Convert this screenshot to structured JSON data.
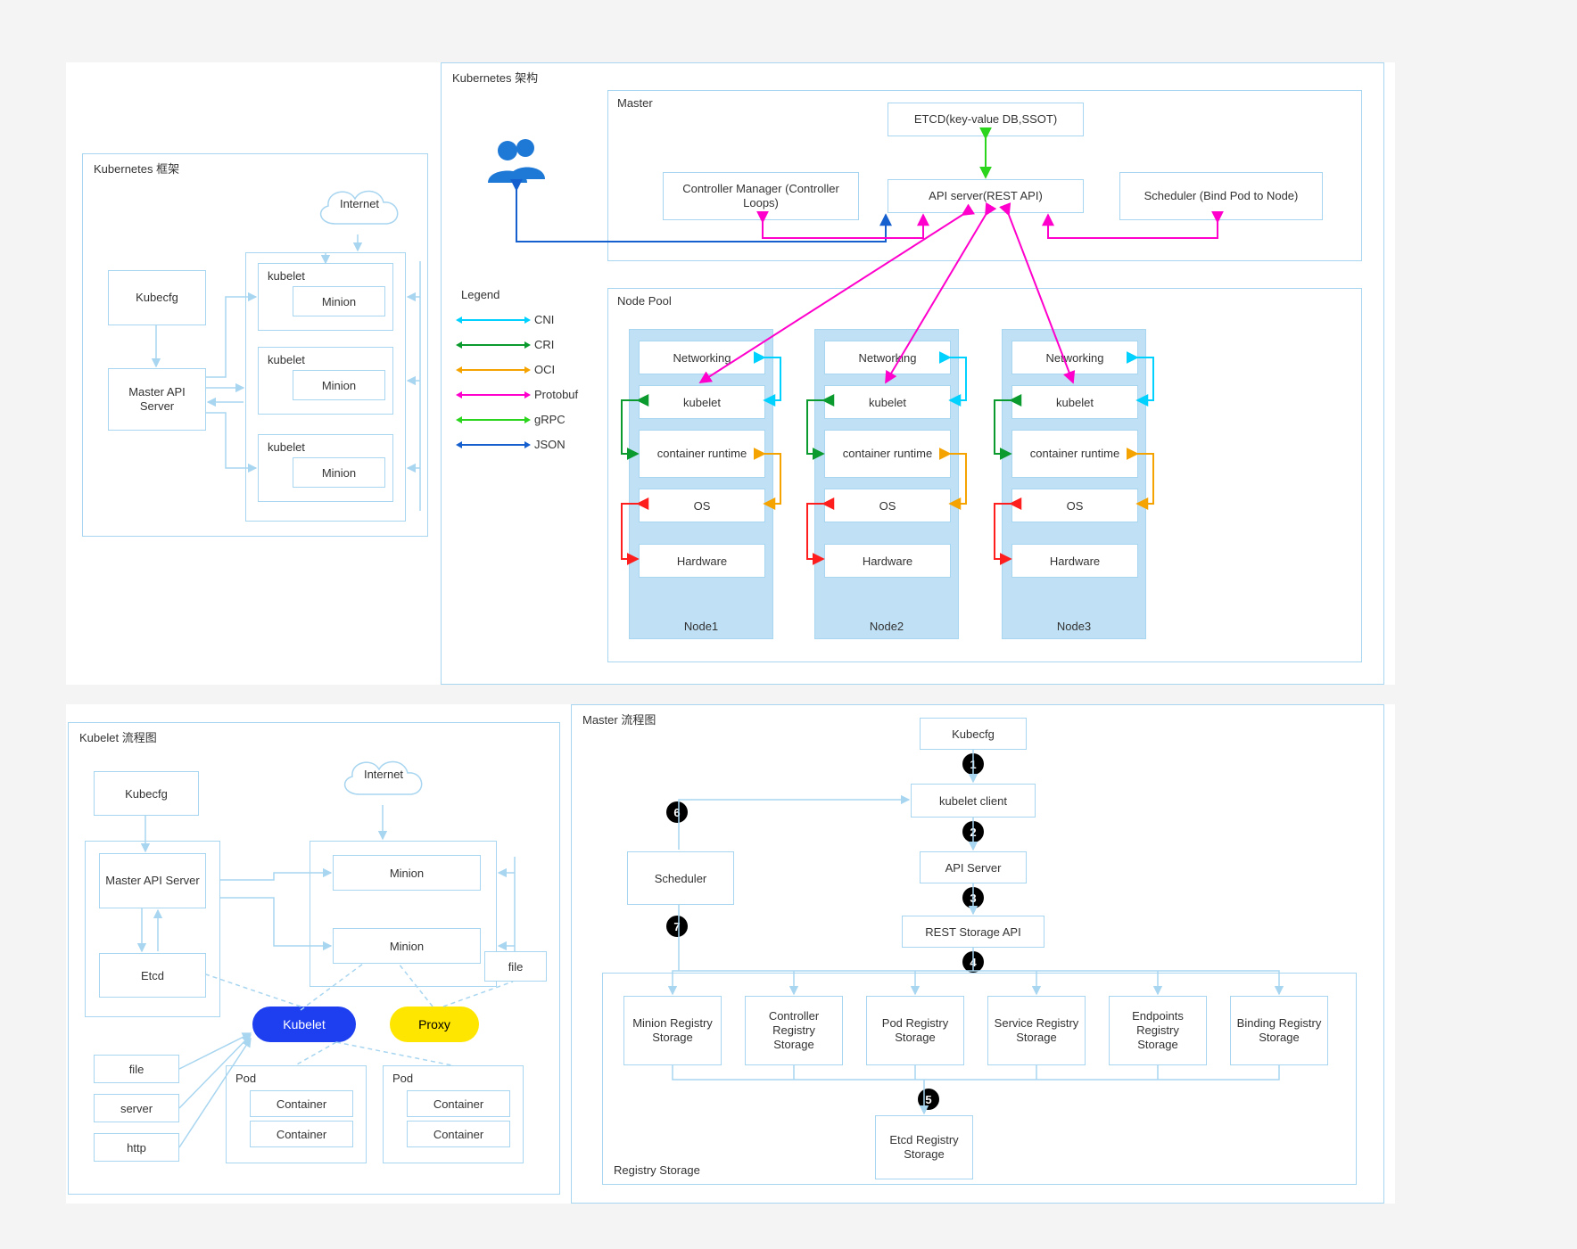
{
  "colors": {
    "border": "#a8d5f0",
    "nodeFill": "#bfe0f5",
    "cni": "#00d1ff",
    "cri": "#0a9a2e",
    "oci": "#f4a300",
    "protobuf": "#ff00cc",
    "grpc": "#2bd41d",
    "json": "#155fcf",
    "hardwareLink": "#ff1e1e",
    "userBlue": "#1e78d6"
  },
  "framework": {
    "title": "Kubernetes 框架",
    "internet": "Internet",
    "kubecfg": "Kubecfg",
    "masterApi": "Master API Server",
    "kubelet": "kubelet",
    "minion": "Minion"
  },
  "arch": {
    "title": "Kubernetes 架构",
    "masterTitle": "Master",
    "etcd": "ETCD(key-value DB,SSOT)",
    "controller": "Controller Manager (Controller Loops)",
    "api": "API server(REST API)",
    "scheduler": "Scheduler (Bind Pod to Node)",
    "legendTitle": "Legend",
    "legend": {
      "cni": "CNI",
      "cri": "CRI",
      "oci": "OCI",
      "protobuf": "Protobuf",
      "grpc": "gRPC",
      "json": "JSON"
    },
    "nodePoolTitle": "Node Pool",
    "layers": {
      "networking": "Networking",
      "kubelet": "kubelet",
      "runtime": "container runtime",
      "os": "OS",
      "hardware": "Hardware"
    },
    "nodes": [
      "Node1",
      "Node2",
      "Node3"
    ]
  },
  "kubeletFlow": {
    "title": "Kubelet 流程图",
    "internet": "Internet",
    "kubecfg": "Kubecfg",
    "masterApi": "Master API Server",
    "etcd": "Etcd",
    "minion": "Minion",
    "file": "file",
    "fileSrc": "file",
    "server": "server",
    "http": "http",
    "kubelet": "Kubelet",
    "proxy": "Proxy",
    "pod": "Pod",
    "container": "Container"
  },
  "masterFlow": {
    "title": "Master 流程图",
    "kubecfg": "Kubecfg",
    "kubeletClient": "kubelet client",
    "apiServer": "API Server",
    "restStorage": "REST Storage API",
    "scheduler": "Scheduler",
    "registryTitle": "Registry Storage",
    "registries": {
      "minion": "Minion Registry Storage",
      "controller": "Controller Registry Storage",
      "pod": "Pod Registry Storage",
      "service": "Service Registry Storage",
      "endpoints": "Endpoints Registry Storage",
      "binding": "Binding Registry Storage"
    },
    "etcdReg": "Etcd Registry Storage",
    "steps": [
      "1",
      "2",
      "3",
      "4",
      "5",
      "6",
      "7"
    ]
  }
}
